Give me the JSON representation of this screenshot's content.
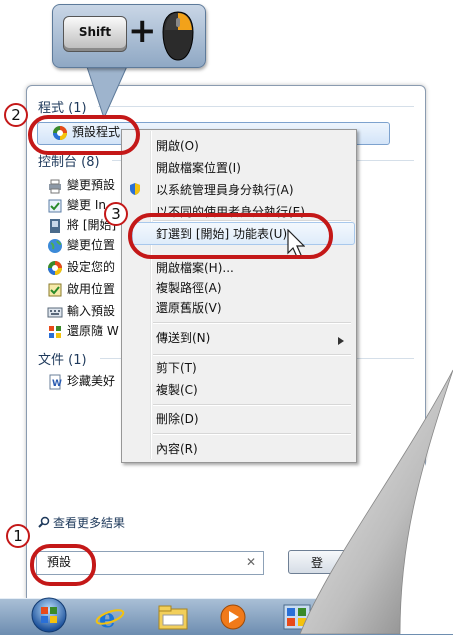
{
  "callout": {
    "key_label": "Shift",
    "plus": "+"
  },
  "groups": {
    "programs": "程式 (1)",
    "control_panel": "控制台 (8)",
    "documents": "文件 (1)"
  },
  "programs_items": [
    {
      "label": "預設程式",
      "icon": "default-programs-icon"
    }
  ],
  "control_panel_items": [
    {
      "label": "變更預設",
      "icon": "printer-icon"
    },
    {
      "label": "變更 In",
      "icon": "checklist-icon"
    },
    {
      "label": "將 [開始]",
      "icon": "user-icon"
    },
    {
      "label": "變更位置",
      "icon": "globe-icon"
    },
    {
      "label": "設定您的",
      "icon": "default-programs-icon"
    },
    {
      "label": "啟用位置",
      "icon": "location-icon"
    },
    {
      "label": "輸入預設",
      "icon": "keyboard-icon"
    },
    {
      "label": "還原隨 W",
      "icon": "windows-shield-icon"
    }
  ],
  "documents_items": [
    {
      "label": "珍藏美好",
      "icon": "word-document-icon"
    }
  ],
  "context_menu": {
    "items": [
      "開啟(O)",
      "開啟檔案位置(I)",
      "以系統管理員身分執行(A)",
      "以不同的使用者身分執行(E)",
      "釘選到 [開始] 功能表(U)",
      "開啟檔案(H)...",
      "複製路徑(A)",
      "還原舊版(V)",
      "傳送到(N)",
      "剪下(T)",
      "複製(C)",
      "刪除(D)",
      "內容(R)"
    ]
  },
  "see_more": "查看更多結果",
  "search": {
    "value": "預設",
    "clear": "✕"
  },
  "shutdown": {
    "label": "登"
  },
  "badges": [
    "1",
    "2",
    "3"
  ],
  "colors": {
    "annotation_red": "#c41818",
    "selection_blue": "#7da2ce",
    "taskbar": "#6d8db0"
  }
}
